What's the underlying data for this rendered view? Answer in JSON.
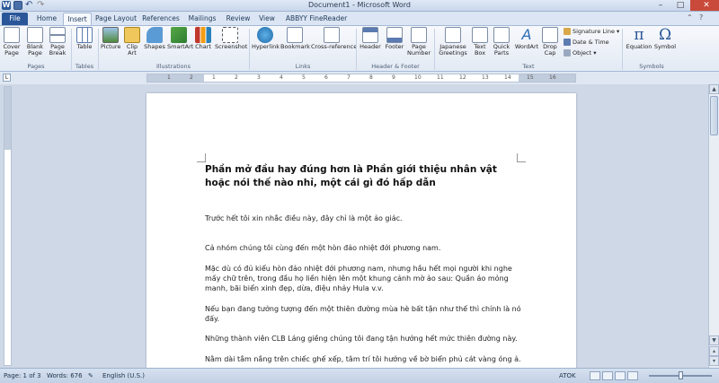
{
  "window": {
    "title": "Document1 - Microsoft Word",
    "qat_undo": "↶",
    "qat_redo": "↷",
    "app_icon_letter": "W"
  },
  "tabs": [
    {
      "label": "File"
    },
    {
      "label": "Home"
    },
    {
      "label": "Insert"
    },
    {
      "label": "Page Layout"
    },
    {
      "label": "References"
    },
    {
      "label": "Mailings"
    },
    {
      "label": "Review"
    },
    {
      "label": "View"
    },
    {
      "label": "ABBYY FineReader 11"
    }
  ],
  "ribbon": {
    "groups": {
      "pages": "Pages",
      "tables": "Tables",
      "illustrations": "Illustrations",
      "links": "Links",
      "header_footer": "Header & Footer",
      "text": "Text",
      "symbols": "Symbols"
    },
    "pages": {
      "cover": [
        "Cover",
        "Page"
      ],
      "blank": [
        "Blank",
        "Page"
      ],
      "break": [
        "Page",
        "Break"
      ]
    },
    "tables": {
      "table": "Table"
    },
    "illustrations": {
      "picture": "Picture",
      "clipart": [
        "Clip",
        "Art"
      ],
      "shapes": "Shapes",
      "smartart": "SmartArt",
      "chart": "Chart",
      "screenshot": "Screenshot"
    },
    "links": {
      "hyperlink": "Hyperlink",
      "bookmark": "Bookmark",
      "crossref": "Cross-reference"
    },
    "header_footer": {
      "header": "Header",
      "footer": "Footer",
      "page_number": [
        "Page",
        "Number"
      ]
    },
    "text": {
      "japanese": [
        "Japanese",
        "Greetings"
      ],
      "textbox": [
        "Text",
        "Box"
      ],
      "quickparts": [
        "Quick",
        "Parts"
      ],
      "wordart": "WordArt",
      "dropcap": [
        "Drop",
        "Cap"
      ],
      "signature": "Signature Line",
      "datetime": "Date & Time",
      "object": "Object"
    },
    "symbols": {
      "equation": "Equation",
      "symbol": "Symbol",
      "equation_glyph": "π",
      "symbol_glyph": "Ω"
    }
  },
  "ruler": {
    "toggle": "L",
    "ticks": [
      "1",
      "2",
      "1",
      "2",
      "3",
      "4",
      "5",
      "6",
      "7",
      "8",
      "9",
      "10",
      "11",
      "12",
      "13",
      "14",
      "15",
      "16"
    ]
  },
  "document": {
    "heading": "Phần mở đầu hay đúng hơn là Phần giới thiệu nhân vật hoặc nói thế nào nhỉ, một cái gì đó hấp dẫn",
    "paragraphs": [
      "Trước hết tôi xin nhắc điều này, đây chỉ là một ảo giác.",
      "Cả nhóm chúng tôi cùng đến một hòn đảo nhiệt đới phương nam.",
      "Mặc dù có đủ kiểu hòn đảo nhiệt đới phương nam, nhưng hầu hết mọi người khi nghe mấy chữ trên, trong đầu họ liền hiện lên một khung cảnh mờ ảo sau: Quần áo mỏng manh, bãi biển xinh đẹp, dừa, điệu nhảy Hula v.v.",
      "Nếu bạn đang tưởng tượng đến một thiên đường mùa hè bất tận như thế thì chính là nó đấy.",
      "Những thành viên CLB Láng giềng chúng tôi đang tận hưởng hết mức thiên đường này.",
      "Nằm dài tắm nắng trên chiếc ghế xếp, tâm trí tôi hướng về bờ biển phủ cát vàng óng ả."
    ]
  },
  "status": {
    "page": "Page: 1 of 3",
    "words": "Words: 676",
    "language": "English (U.S.)",
    "input": "ATOK"
  },
  "colors": {
    "file_tab": "#2a5699",
    "accent": "#1e395b"
  }
}
